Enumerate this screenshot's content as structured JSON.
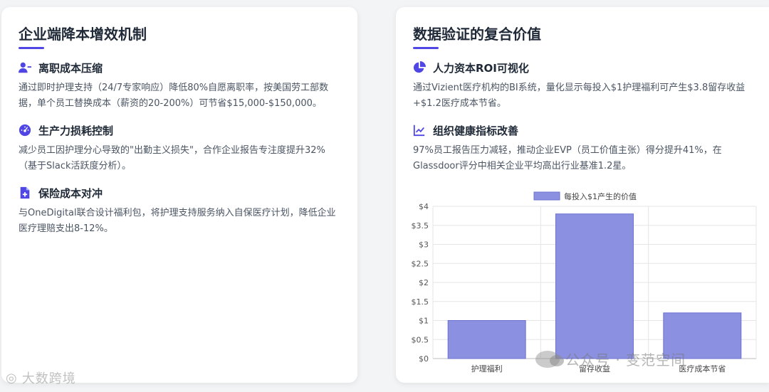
{
  "left_card": {
    "title": "企业端降本增效机制",
    "sections": [
      {
        "icon": "user-minus-icon",
        "title": "离职成本压缩",
        "body": "通过即时护理支持（24/7专家响应）降低80%自愿离职率，按美国劳工部数据，单个员工替换成本（薪资的20-200%）可节省$15,000-$150,000。"
      },
      {
        "icon": "gauge-icon",
        "title": "生产力损耗控制",
        "body": "减少员工因护理分心导致的\"出勤主义损失\"，合作企业报告专注度提升32%（基于Slack活跃度分析）。"
      },
      {
        "icon": "file-medical-icon",
        "title": "保险成本对冲",
        "body": "与OneDigital联合设计福利包，将护理支持服务纳入自保医疗计划，降低企业医疗理赔支出8-12%。"
      }
    ]
  },
  "right_card": {
    "title": "数据验证的复合价值",
    "sections": [
      {
        "icon": "pie-chart-icon",
        "title": "人力资本ROI可视化",
        "body": "通过Vizient医疗机构的BI系统，量化显示每投入$1护理福利可产生$3.8留存收益+$1.2医疗成本节省。"
      },
      {
        "icon": "line-chart-icon",
        "title": "组织健康指标改善",
        "body": "97%员工报告压力减轻，推动企业EVP（员工价值主张）得分提升41%，在Glassdoor评分中相关企业平均高出行业基准1.2星。"
      }
    ]
  },
  "chart_data": {
    "type": "bar",
    "categories": [
      "护理福利",
      "留存收益",
      "医疗成本节省"
    ],
    "series": [
      {
        "name": "每投入$1产生的价值",
        "values": [
          1.0,
          3.8,
          1.2
        ]
      }
    ],
    "yticks": [
      "$0",
      "$0.5",
      "$1",
      "$1.5",
      "$2",
      "$2.5",
      "$3",
      "$3.5",
      "$4"
    ],
    "ylim": [
      0,
      4
    ],
    "grid": true,
    "legend": "top",
    "bar_color": "#8b90e0",
    "bar_border": "#6b70d0"
  },
  "watermarks": {
    "right": "公众号 · 变范空间",
    "left": "大数跨境"
  },
  "colors": {
    "accent": "#4f46e5",
    "heading": "#1f2937"
  }
}
